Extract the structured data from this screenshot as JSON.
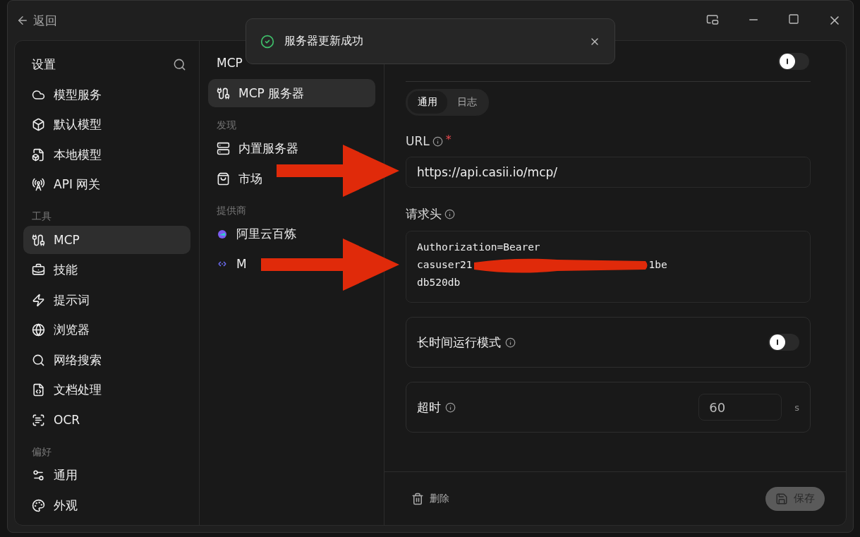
{
  "titlebar": {
    "back": "返回"
  },
  "toast": {
    "message": "服务器更新成功"
  },
  "sidebar": {
    "title": "设置",
    "groups": [
      {
        "items": [
          {
            "label": "模型服务",
            "selected": false
          },
          {
            "label": "默认模型",
            "selected": false
          },
          {
            "label": "本地模型",
            "selected": false
          },
          {
            "label": "API 网关",
            "selected": false
          }
        ]
      },
      {
        "heading": "工具",
        "items": [
          {
            "label": "MCP",
            "selected": true
          },
          {
            "label": "技能",
            "selected": false
          },
          {
            "label": "提示词",
            "selected": false
          },
          {
            "label": "浏览器",
            "selected": false
          },
          {
            "label": "网络搜索",
            "selected": false
          },
          {
            "label": "文档处理",
            "selected": false
          },
          {
            "label": "OCR",
            "selected": false
          }
        ]
      },
      {
        "heading": "偏好",
        "items": [
          {
            "label": "通用",
            "selected": false
          },
          {
            "label": "外观",
            "selected": false
          }
        ]
      }
    ]
  },
  "mcp_nav": {
    "title": "MCP",
    "groups": [
      {
        "items": [
          {
            "label": "MCP 服务器",
            "selected": true
          }
        ]
      },
      {
        "heading": "发现",
        "items": [
          {
            "label": "内置服务器",
            "selected": false
          },
          {
            "label": "市场",
            "selected": false
          }
        ]
      },
      {
        "heading": "提供商",
        "items": [
          {
            "label": "阿里云百炼",
            "selected": false
          },
          {
            "label": "M",
            "selected": false
          }
        ]
      }
    ]
  },
  "server": {
    "enabled": false,
    "tabs": [
      {
        "label": "通用",
        "selected": true
      },
      {
        "label": "日志",
        "selected": false
      }
    ],
    "url": {
      "label": "URL",
      "required_mark": "*",
      "value": "https://api.casii.io/mcp/"
    },
    "headers": {
      "label": "请求头",
      "lines": [
        [
          "Authorization=Bearer"
        ],
        [
          "casuser21",
          "1be"
        ],
        [
          "db520db"
        ]
      ]
    },
    "long_running": {
      "label": "长时间运行模式",
      "on": false
    },
    "timeout": {
      "label": "超时",
      "value": "60",
      "unit": "s"
    },
    "delete": "删除",
    "save": {
      "label": "保存",
      "disabled": true
    }
  }
}
